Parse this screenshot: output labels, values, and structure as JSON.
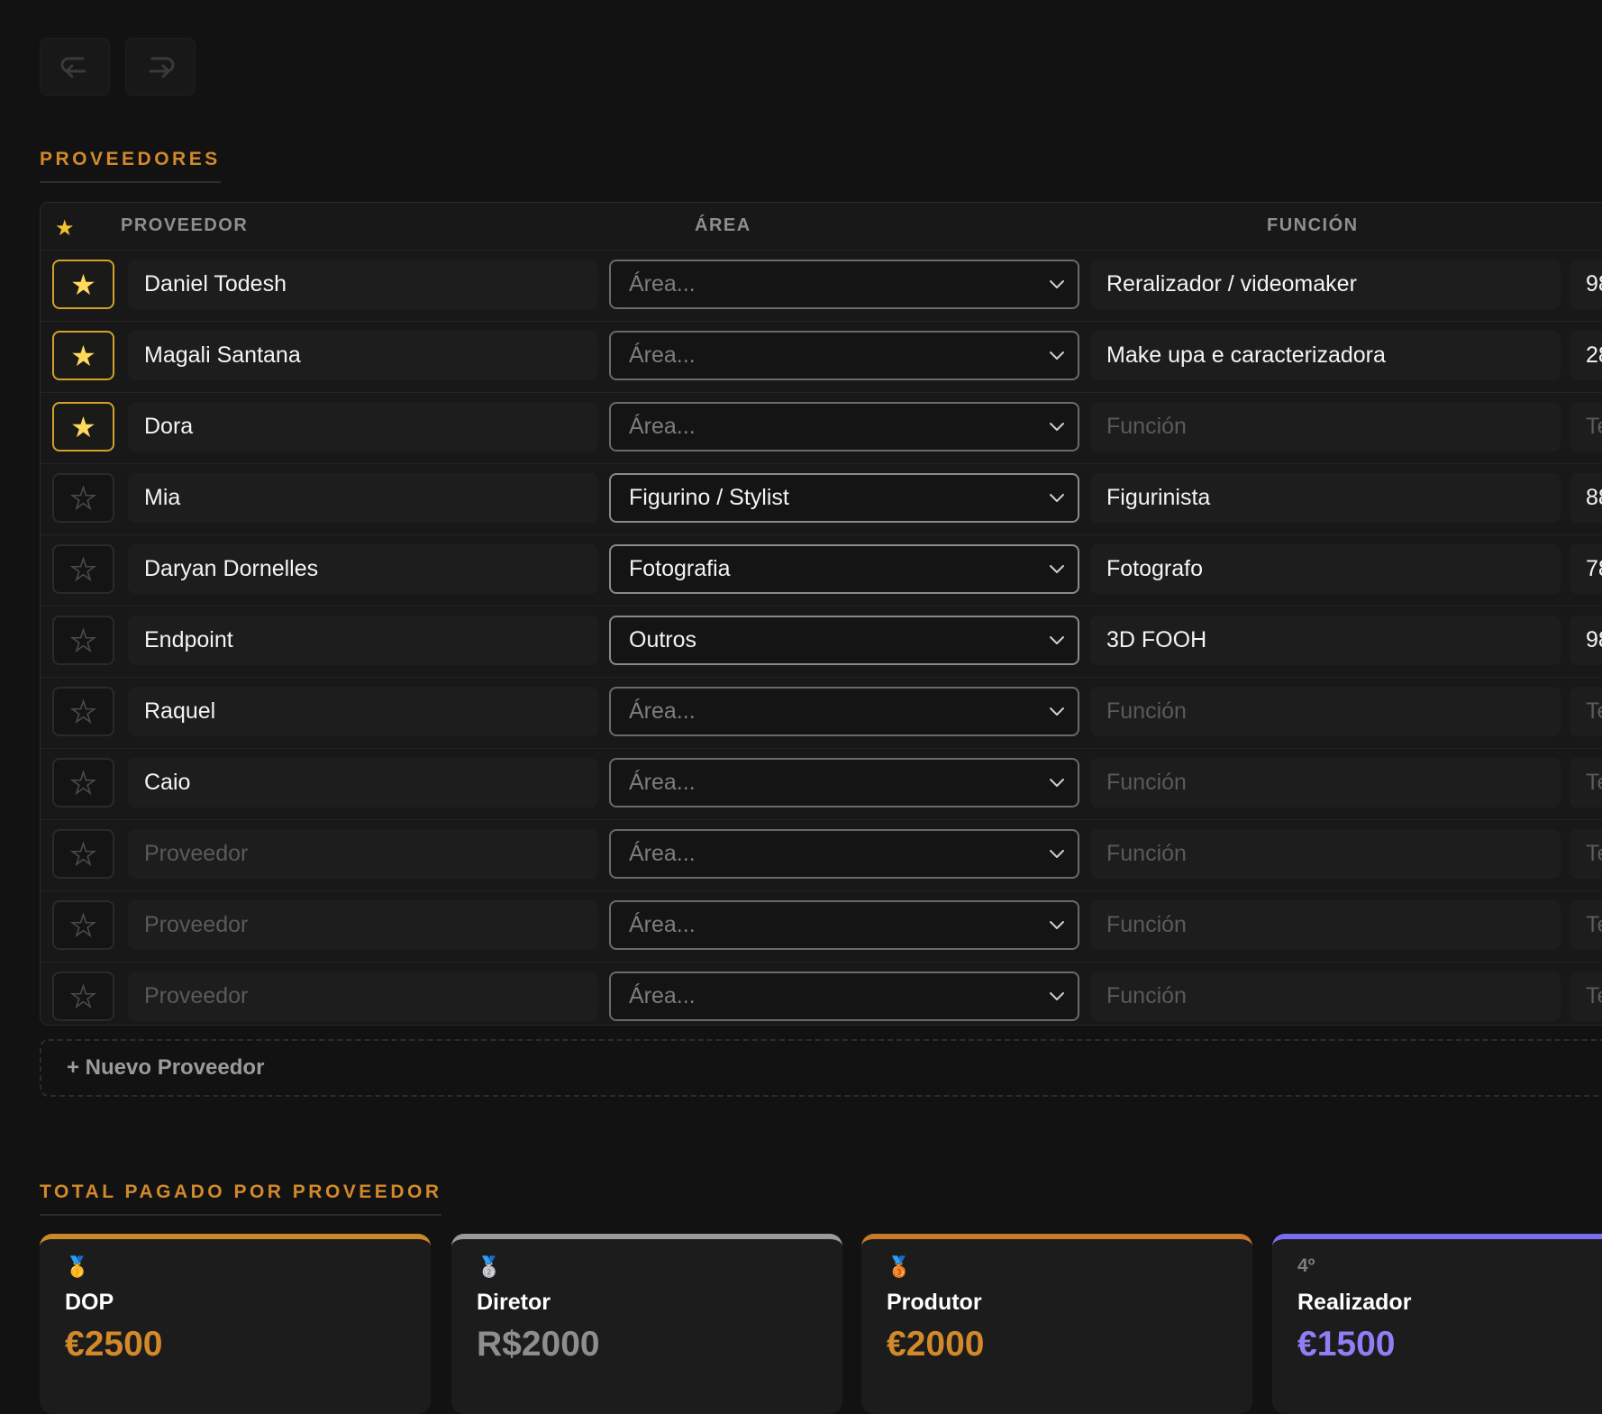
{
  "history": {
    "undo_icon": "undo-icon",
    "redo_icon": "redo-icon"
  },
  "providers_section": {
    "title": "PROVEEDORES",
    "columns": {
      "star": "★",
      "provider": "PROVEEDOR",
      "area": "ÁREA",
      "function": "FUNCIÓN"
    },
    "rows": [
      {
        "favorite": true,
        "name": "Daniel Todesh",
        "area": "Área...",
        "function": "Reralizador / videomaker",
        "extra": "98"
      },
      {
        "favorite": true,
        "name": "Magali Santana",
        "area": "Área...",
        "function": "Make upa e caracterizadora",
        "extra": "28"
      },
      {
        "favorite": true,
        "name": "Dora",
        "area": "Área...",
        "function": "Función",
        "extra": "Te"
      },
      {
        "favorite": false,
        "name": "Mia",
        "area": "Figurino / Stylist",
        "function": "Figurinista",
        "extra": "88"
      },
      {
        "favorite": false,
        "name": "Daryan Dornelles",
        "area": "Fotografia",
        "function": "Fotografo",
        "extra": "78"
      },
      {
        "favorite": false,
        "name": "Endpoint",
        "area": "Outros",
        "function": "3D FOOH",
        "extra": "98"
      },
      {
        "favorite": false,
        "name": "Raquel",
        "area": "Área...",
        "function": "Función",
        "extra": "Te"
      },
      {
        "favorite": false,
        "name": "Caio",
        "area": "Área...",
        "function": "Función",
        "extra": "Te"
      },
      {
        "favorite": false,
        "name": "Proveedor",
        "area": "Área...",
        "function": "Función",
        "extra": "Te"
      },
      {
        "favorite": false,
        "name": "Proveedor",
        "area": "Área...",
        "function": "Función",
        "extra": "Te"
      },
      {
        "favorite": false,
        "name": "Proveedor",
        "area": "Área...",
        "function": "Función",
        "extra": "Te"
      }
    ],
    "add_label": "+ Nuevo Proveedor"
  },
  "totals_section": {
    "title": "TOTAL PAGADO POR PROVEEDOR",
    "cards": [
      {
        "badge": "🥇",
        "role": "DOP",
        "amount": "€2500",
        "accent": "#c8892a",
        "amount_color": "#d2892a"
      },
      {
        "badge": "🥈",
        "role": "Diretor",
        "amount": "R$2000",
        "accent": "#9a9a9a",
        "amount_color": "#8e8e8e"
      },
      {
        "badge": "🥉",
        "role": "Produtor",
        "amount": "€2000",
        "accent": "#c8792a",
        "amount_color": "#d2892a"
      },
      {
        "badge": "4º",
        "role": "Realizador",
        "amount": "€1500",
        "accent": "#7b6cf0",
        "amount_color": "#8f7ef5"
      }
    ]
  },
  "colors": {
    "accent": "#d2892a",
    "background": "#121212",
    "star_on": "#ffd95c"
  }
}
